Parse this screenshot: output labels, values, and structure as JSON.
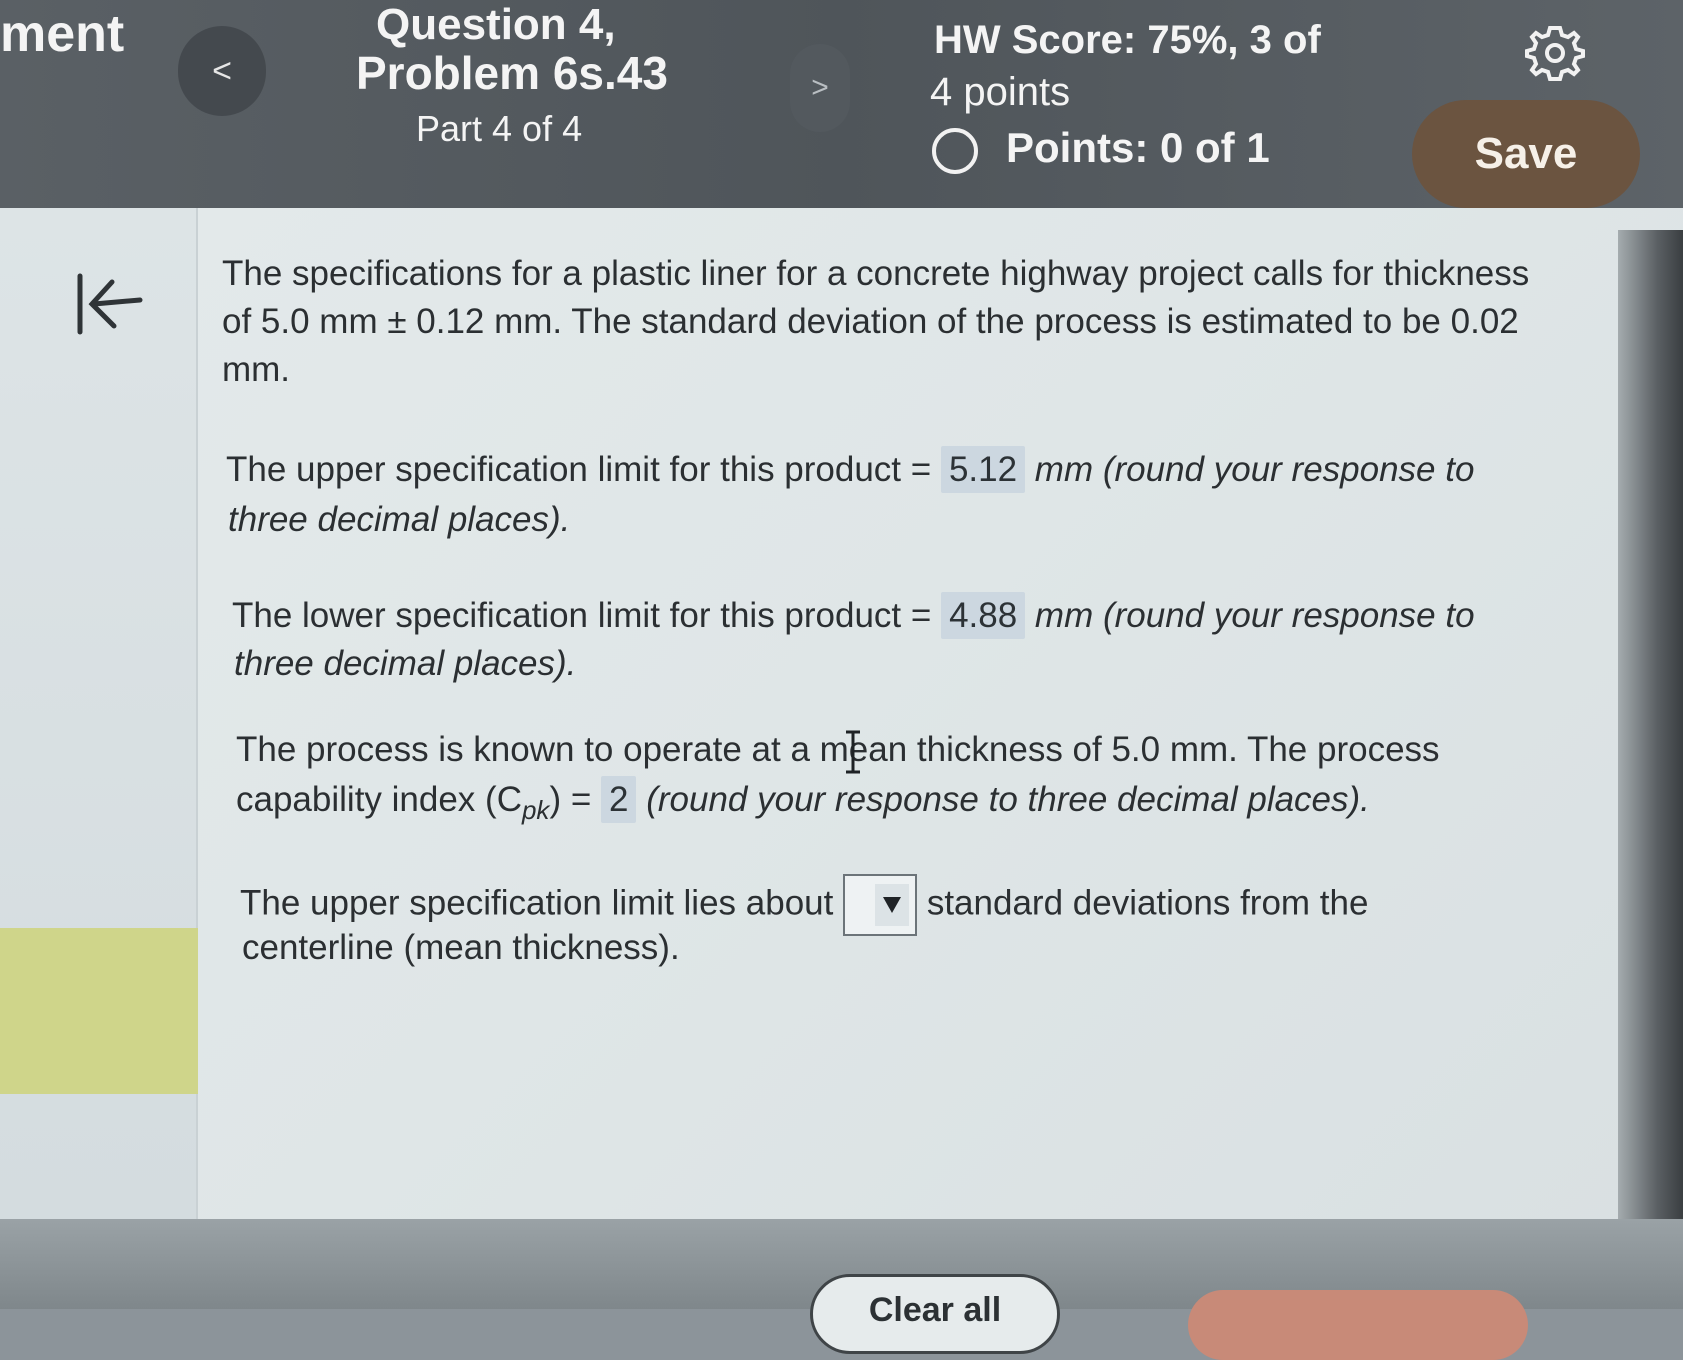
{
  "header": {
    "partial_left_label": "ment",
    "question_line1": "Question 4,",
    "question_line2": "Problem 6s.43",
    "part": "Part 4 of 4",
    "prev_label": "<",
    "next_label": ">",
    "hw_score_line1": "HW Score: 75%, 3 of",
    "hw_score_line2": "4 points",
    "points": "Points: 0 of 1",
    "save_label": "Save"
  },
  "question": {
    "intro_line1": "The specifications for a plastic liner for a concrete highway project calls for thickness",
    "intro_line2": "of 5.0 mm ± 0.12 mm.  The standard deviation of the process is estimated to be 0.02",
    "intro_line3": "mm.",
    "usl_prefix": "The upper specification limit for this product =",
    "usl_value": "5.12",
    "usl_suffix": "mm (round your response to",
    "usl_line2": "three decimal places).",
    "lsl_prefix": "The lower specification limit for this product =",
    "lsl_value": "4.88",
    "lsl_suffix": "mm (round your response to",
    "lsl_line2": "three decimal places).",
    "cpk_line1": "The process is known to operate at a mean thickness of 5.0 mm.  The process",
    "cpk_prefix": "capability index (C",
    "cpk_sub": "pk",
    "cpk_eq": ") =",
    "cpk_value": "2",
    "cpk_suffix": "(round your response to three decimal places).",
    "std_prefix": "The upper specification limit lies about",
    "std_suffix": "standard deviations from the",
    "std_line2": "centerline (mean thickness)."
  },
  "footer": {
    "clear_all_label": "Clear all"
  },
  "colors": {
    "header_bg": "#53595e",
    "save_button": "#6b5440",
    "answer_bg": "#ccd7e0",
    "sidebar_accent": "#cfd58a"
  },
  "icons": {
    "gear": "gear-icon",
    "collapse": "collapse-left-icon",
    "points_status": "empty-circle-icon",
    "dropdown": "caret-down-icon"
  }
}
